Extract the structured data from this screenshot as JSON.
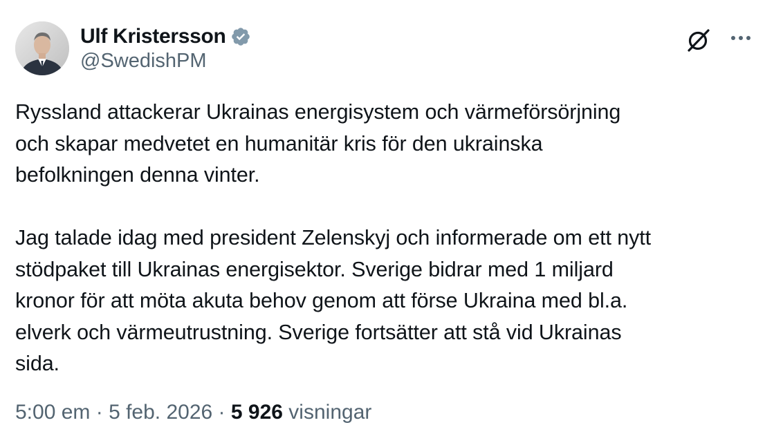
{
  "author": {
    "display_name": "Ulf Kristersson",
    "handle": "@SwedishPM",
    "verified_badge_icon": "verified-gray-badge-icon"
  },
  "header_actions": {
    "grok_icon": "grok-icon",
    "more_icon": "more-options-icon"
  },
  "tweet": {
    "paragraphs": [
      "Ryssland attackerar Ukrainas energisystem och värmeförsörjning\noch skapar medvetet en humanitär kris för den ukrainska\nbefolkningen denna vinter.",
      "Jag talade idag med president Zelenskyj och informerade om ett nytt\nstödpaket till Ukrainas energisektor. Sverige bidrar med 1 miljard\nkronor för att möta akuta behov genom att förse Ukraina med bl.a.\nelverk och värmeutrustning. Sverige fortsätter att stå vid Ukrainas\nsida."
    ]
  },
  "meta": {
    "time": "5:00 em",
    "separator": " · ",
    "date": "5 feb. 2026",
    "views_count": "5 926",
    "views_label": " visningar"
  },
  "colors": {
    "text_primary": "#0f1419",
    "text_secondary": "#536471",
    "badge": "#829aab",
    "background": "#ffffff"
  }
}
